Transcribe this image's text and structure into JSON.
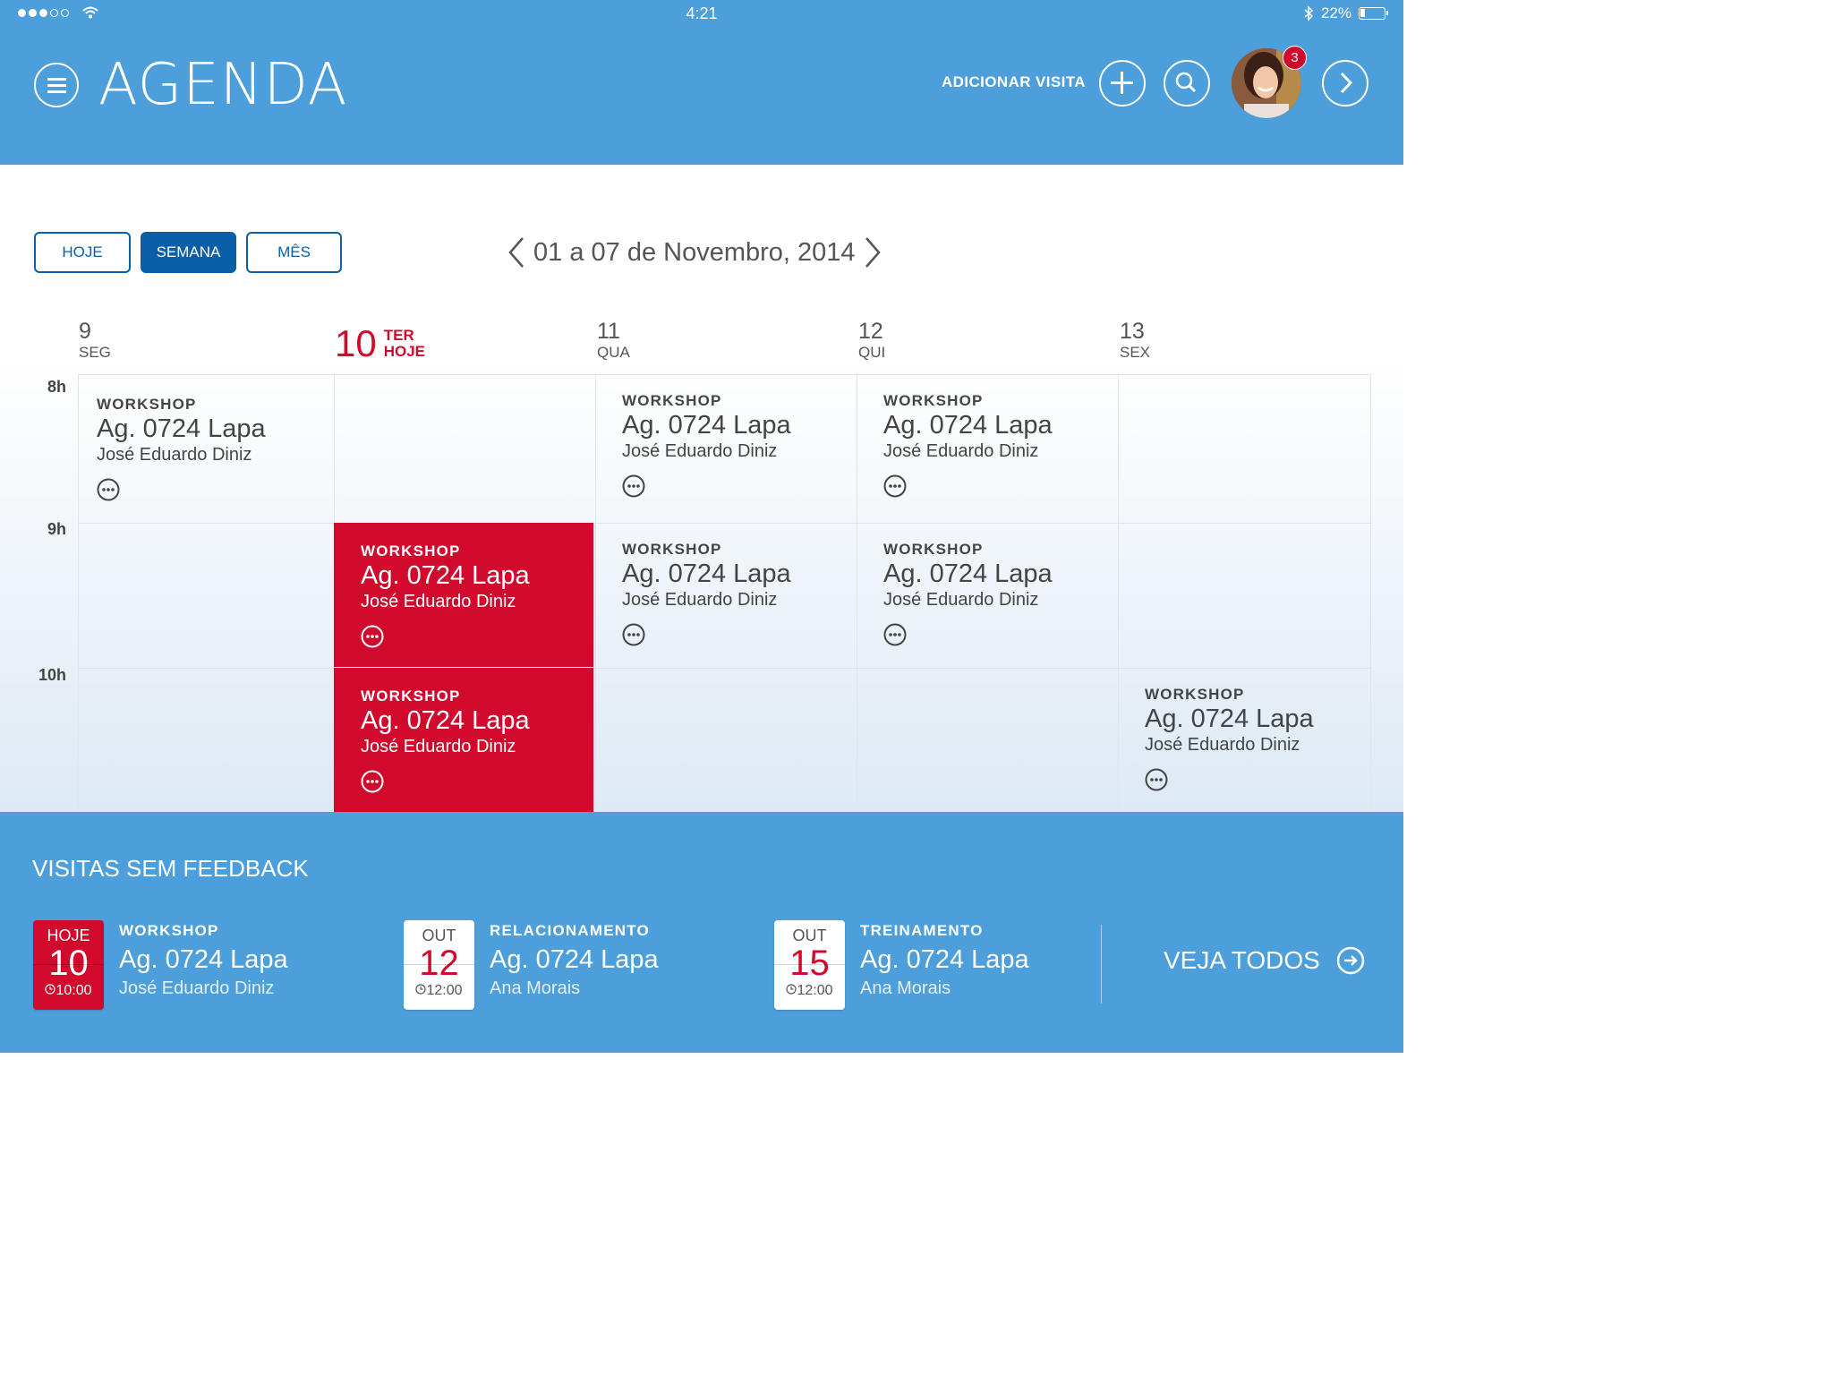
{
  "status_bar": {
    "time": "4:21",
    "battery": "22%"
  },
  "header": {
    "title": "AGENDA",
    "add_visit_label": "ADICIONAR VISITA",
    "notification_count": "3"
  },
  "view_tabs": {
    "today": "HOJE",
    "week": "SEMANA",
    "month": "MÊS",
    "active": "week"
  },
  "date_nav": {
    "range": "01 a 07 de Novembro, 2014"
  },
  "days": [
    {
      "num": "9",
      "name": "SEG"
    },
    {
      "num": "10",
      "name": "TER",
      "tag": "HOJE"
    },
    {
      "num": "11",
      "name": "QUA"
    },
    {
      "num": "12",
      "name": "QUI"
    },
    {
      "num": "13",
      "name": "SEX"
    }
  ],
  "hours": [
    "8h",
    "9h",
    "10h"
  ],
  "events": [
    {
      "type": "WORKSHOP",
      "place": "Ag. 0724 Lapa",
      "person": "José Eduardo Diniz",
      "today": false
    },
    {
      "type": "WORKSHOP",
      "place": "Ag. 0724 Lapa",
      "person": "José Eduardo Diniz",
      "today": false
    },
    {
      "type": "WORKSHOP",
      "place": "Ag. 0724 Lapa",
      "person": "José Eduardo Diniz",
      "today": false
    },
    {
      "type": "WORKSHOP",
      "place": "Ag. 0724 Lapa",
      "person": "José Eduardo Diniz",
      "today": true
    },
    {
      "type": "WORKSHOP",
      "place": "Ag. 0724 Lapa",
      "person": "José Eduardo Diniz",
      "today": false
    },
    {
      "type": "WORKSHOP",
      "place": "Ag. 0724 Lapa",
      "person": "José Eduardo Diniz",
      "today": false
    },
    {
      "type": "WORKSHOP",
      "place": "Ag. 0724 Lapa",
      "person": "José Eduardo Diniz",
      "today": true
    },
    {
      "type": "WORKSHOP",
      "place": "Ag. 0724 Lapa",
      "person": "José Eduardo Diniz",
      "today": false
    }
  ],
  "feedback": {
    "title": "VISITAS SEM FEEDBACK",
    "see_all": "VEJA TODOS",
    "items": [
      {
        "month": "HOJE",
        "day": "10",
        "time": "10:00",
        "type": "WORKSHOP",
        "place": "Ag. 0724 Lapa",
        "person": "José Eduardo Diniz",
        "today": true
      },
      {
        "month": "OUT",
        "day": "12",
        "time": "12:00",
        "type": "RELACIONAMENTO",
        "place": "Ag. 0724 Lapa",
        "person": "Ana Morais",
        "today": false
      },
      {
        "month": "OUT",
        "day": "15",
        "time": "12:00",
        "type": "TREINAMENTO",
        "place": "Ag. 0724 Lapa",
        "person": "Ana Morais",
        "today": false
      }
    ]
  },
  "colors": {
    "header_blue": "#4d9fdb",
    "accent_red": "#d10a2d",
    "button_blue": "#0b5ea8"
  }
}
